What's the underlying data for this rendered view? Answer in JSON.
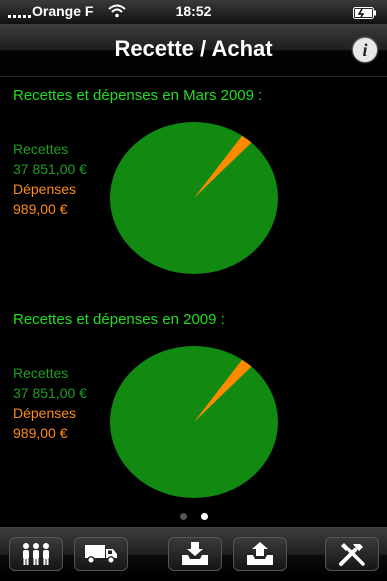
{
  "status_bar": {
    "carrier": "Orange F",
    "time": "18:52",
    "icons": [
      "signal-icon",
      "wifi-icon",
      "battery-icon"
    ]
  },
  "nav": {
    "title": "Recette / Achat",
    "info_icon": "info-icon"
  },
  "sections": [
    {
      "title": "Recettes et dépenses en Mars 2009 :",
      "recettes_label": "Recettes",
      "recettes_value": "37 851,00 €",
      "depenses_label": "Dépenses",
      "depenses_value": "989,00 €"
    },
    {
      "title": "Recettes et dépenses en 2009 :",
      "recettes_label": "Recettes",
      "recettes_value": "37 851,00 €",
      "depenses_label": "Dépenses",
      "depenses_value": "989,00 €"
    }
  ],
  "colors": {
    "recettes": "#128a12",
    "depenses": "#ff8a00",
    "title": "#22dd22"
  },
  "page_indicator": {
    "count": 2,
    "active": 1
  },
  "toolbar": {
    "buttons": [
      "people-icon",
      "truck-icon",
      "inbox-download-icon",
      "inbox-upload-icon",
      "tools-icon"
    ]
  }
}
